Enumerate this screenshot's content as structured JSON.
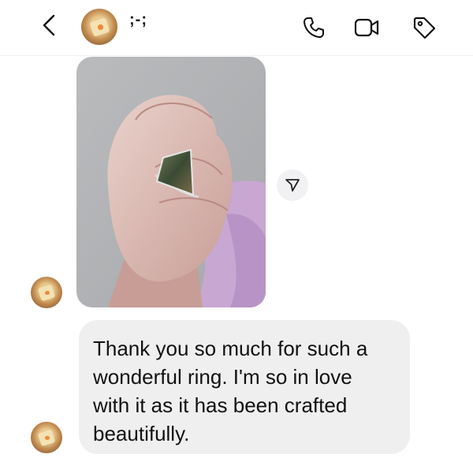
{
  "header": {
    "contact_name": ";-;",
    "icons": [
      "back-chevron-icon",
      "phone-icon",
      "video-camera-icon",
      "tag-icon"
    ]
  },
  "messages": [
    {
      "type": "photo",
      "description_icon": "ring-photo",
      "share_icon": "send-arrow-icon"
    },
    {
      "type": "text",
      "text": "Thank you so much for such a wonderful ring. I'm so in love with it as it has been crafted beautifully."
    }
  ],
  "colors": {
    "bubble_bg": "#efefef",
    "text": "#111111",
    "share_button_bg": "#f1f1f3"
  }
}
